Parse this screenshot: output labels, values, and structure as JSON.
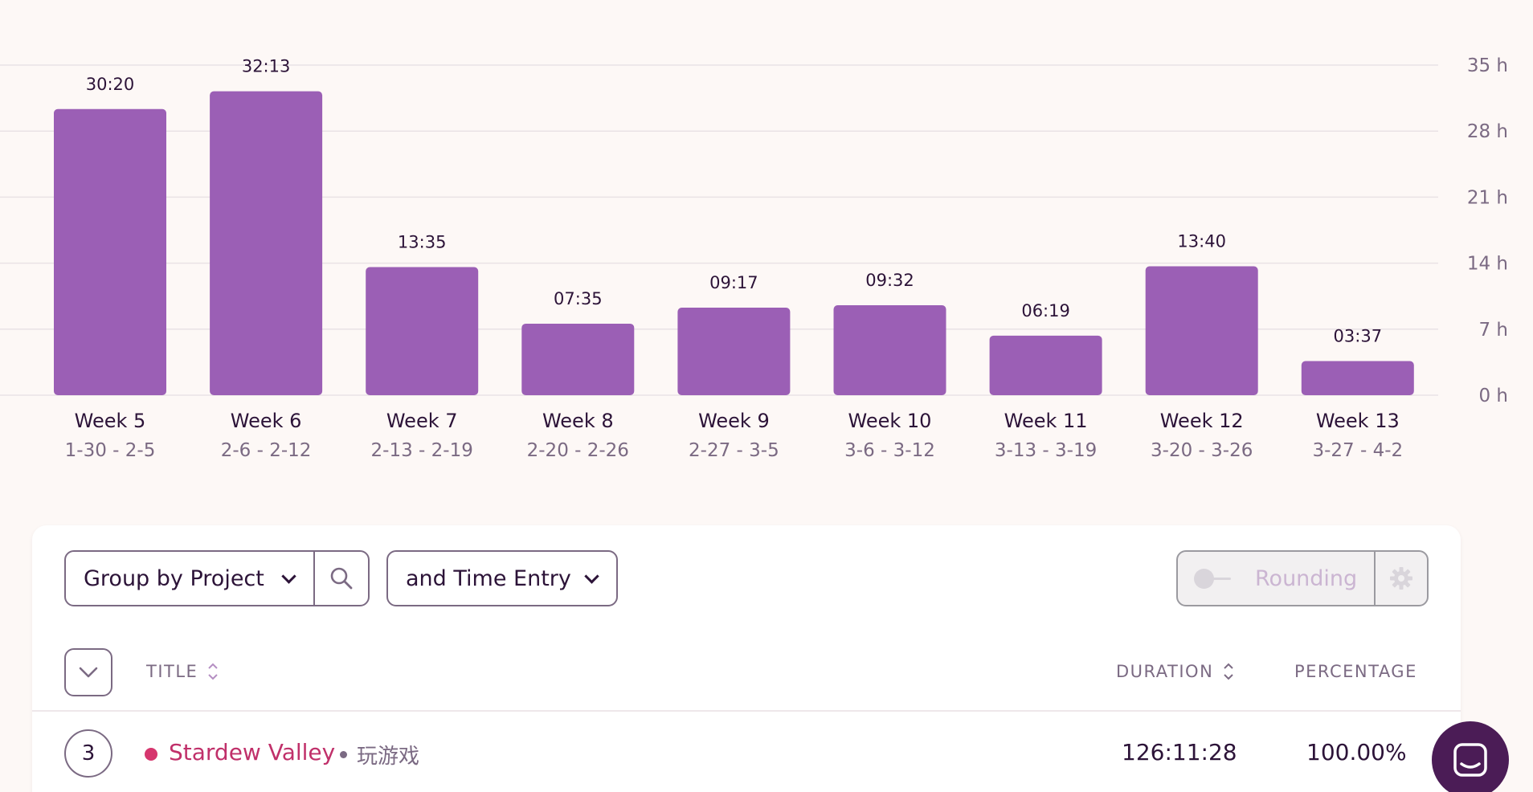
{
  "chart_data": {
    "type": "bar",
    "categories": [
      "Week 5",
      "Week 6",
      "Week 7",
      "Week 8",
      "Week 9",
      "Week 10",
      "Week 11",
      "Week 12",
      "Week 13"
    ],
    "date_ranges": [
      "1-30 - 2-5",
      "2-6 - 2-12",
      "2-13 - 2-19",
      "2-20 - 2-26",
      "2-27 - 3-5",
      "3-6 - 3-12",
      "3-13 - 3-19",
      "3-20 - 3-26",
      "3-27 - 4-2"
    ],
    "values": [
      30.333,
      32.217,
      13.583,
      7.583,
      9.283,
      9.533,
      6.317,
      13.667,
      3.617
    ],
    "data_labels": [
      "30:20",
      "32:13",
      "13:35",
      "07:35",
      "09:17",
      "09:32",
      "06:19",
      "13:40",
      "03:37"
    ],
    "ylim": [
      0,
      35
    ],
    "y_ticks": [
      0,
      7,
      14,
      21,
      28,
      35
    ],
    "y_tick_labels": [
      "0 h",
      "7 h",
      "14 h",
      "21 h",
      "28 h",
      "35 h"
    ],
    "grid": true,
    "y_axis_side": "right",
    "bar_color": "#9b5fb5",
    "title": "",
    "xlabel": "",
    "ylabel": ""
  },
  "controls": {
    "group_by_label": "Group by Project",
    "sub_group_label": "and Time Entry",
    "rounding_label": "Rounding",
    "rounding_enabled": false
  },
  "table": {
    "headers": {
      "title": "TITLE",
      "duration": "DURATION",
      "percentage": "PERCENTAGE"
    },
    "rows": [
      {
        "count": "3",
        "project": "Stardew Valley",
        "client": "玩游戏",
        "duration": "126:11:28",
        "percentage": "100.00%",
        "project_color": "#d6366e"
      }
    ]
  },
  "colors": {
    "background": "#fdf8f6",
    "text_primary": "#2c1338",
    "text_muted": "#7b6a83",
    "project_text": "#c0306a",
    "chat_launcher": "#4b1c56"
  },
  "icons": {
    "search": "search-icon",
    "dropdown": "chevron-down-icon",
    "settings": "gear-icon",
    "expand": "chevron-down-icon",
    "sort": "sort-icon",
    "chat": "chat-icon"
  }
}
